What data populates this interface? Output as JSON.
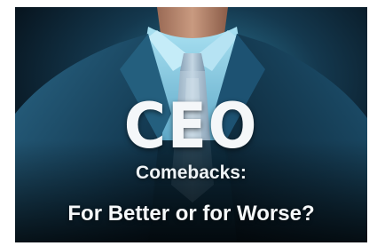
{
  "image": {
    "subject": "man-in-suit-photo",
    "colors": {
      "background_dark": "#0a1e2c",
      "suit": "#1d4e6b",
      "shirt": "#8fd0e8",
      "tie": "#9fb4c6",
      "skin": "#c08a6e",
      "text": "#f4f7f9"
    }
  },
  "headline": {
    "main": "CEO",
    "sub": "Comebacks:",
    "question": "For Better or for Worse?"
  }
}
